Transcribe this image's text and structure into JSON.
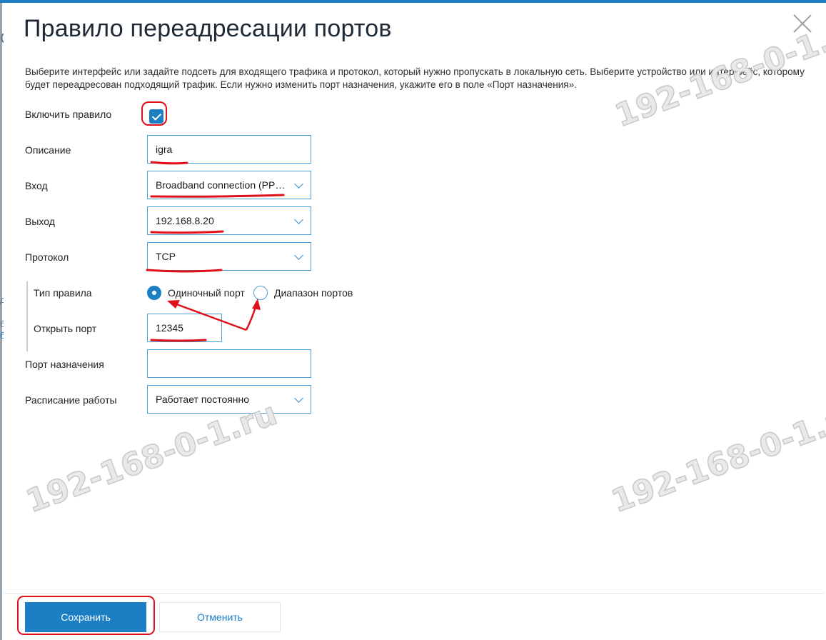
{
  "dialog": {
    "title": "Правило переадресации портов",
    "description": "Выберите интерфейс или задайте подсеть для входящего трафика и протокол, который нужно пропускать в локальную сеть. Выберите устройство или интерфейс, которому будет переадресован подходящий трафик. Если нужно изменить порт назначения, укажите его в поле «Порт назначения»."
  },
  "background_fragments": [
    "с",
    "д",
    "б",
    "б"
  ],
  "form": {
    "enable_rule": {
      "label": "Включить правило",
      "checked": true
    },
    "description": {
      "label": "Описание",
      "value": "igra"
    },
    "input": {
      "label": "Вход",
      "value": "Broadband connection (PPPoE)"
    },
    "output": {
      "label": "Выход",
      "value": "192.168.8.20"
    },
    "protocol": {
      "label": "Протокол",
      "value": "TCP"
    },
    "rule_type": {
      "label": "Тип правила",
      "options": [
        "Одиночный порт",
        "Диапазон портов"
      ],
      "selected": "Одиночный порт"
    },
    "open_port": {
      "label": "Открыть порт",
      "value": "12345"
    },
    "destination_port": {
      "label": "Порт назначения",
      "value": ""
    },
    "schedule": {
      "label": "Расписание работы",
      "value": "Работает постоянно"
    }
  },
  "buttons": {
    "save": "Сохранить",
    "cancel": "Отменить"
  },
  "watermark": "192-168-0-1.ru",
  "colors": {
    "accent": "#1c7fc4",
    "field_border": "#4a9fd6",
    "annotation_red": "#e0101a"
  }
}
